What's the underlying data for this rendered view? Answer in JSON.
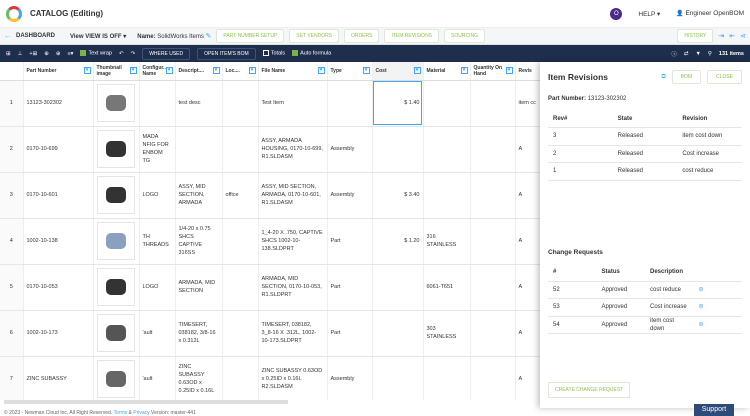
{
  "header": {
    "title": "CATALOG (Editing)",
    "avatar": "O",
    "help": "HELP ▾",
    "user": "Engineer OpenBOM"
  },
  "nav": {
    "dashboard": "DASHBOARD",
    "view": "View VIEW IS OFF ▾",
    "name_label": "Name:",
    "name": "SolidWorks Items",
    "tabs": [
      "PART NUMBER SETUP",
      "SET VENDORS",
      "ORDERS",
      "ITEM REVISIONS",
      "SOURCING"
    ],
    "history": "HISTORY"
  },
  "toolbar": {
    "text_wrap": "Text wrap",
    "where_used": "WHERE USED",
    "open_bom": "OPEN ITEM'S BOM",
    "totals": "Totals",
    "auto_formula": "Auto formula",
    "count": "131 items"
  },
  "columns": [
    "",
    "Part Number",
    "Thumbnail image",
    "Configur... Name",
    "Descript....",
    "Loc....",
    "File Name",
    "Type",
    "Cost",
    "Material",
    "Quantity On Hand",
    "Revis"
  ],
  "rows": [
    {
      "n": "1",
      "part": "13123-302302",
      "config": "",
      "desc": "test desc",
      "loc": "",
      "file": "Test Item",
      "type": "",
      "cost": "$ 1.40",
      "material": "",
      "qty": "",
      "rev": "item cc"
    },
    {
      "n": "2",
      "part": "0170-10-699",
      "config": "MADA NFIG FOR ENBOM TG",
      "desc": "",
      "loc": "",
      "file": "ASSY, ARMADA HOUSING, 0170-10-699, R1.SLDASM",
      "type": "Assembly",
      "cost": "",
      "material": "",
      "qty": "",
      "rev": "A"
    },
    {
      "n": "3",
      "part": "0170-10-601",
      "config": "LOGO",
      "desc": "ASSY, MID SECTION, ARMADA",
      "loc": "office",
      "file": "ASSY, MID SECTION, ARMADA, 0170-10-601, R1.SLDASM",
      "type": "Assembly",
      "cost": "$ 3.40",
      "material": "",
      "qty": "",
      "rev": "A"
    },
    {
      "n": "4",
      "part": "1002-10-138",
      "config": "TH THREADS",
      "desc": "1/4-20 x 0.75 SHCS CAPTIVE 316SS",
      "loc": "",
      "file": "1_4-20 X .750, CAPTIVE SHCS 1002-10-138.SLDPRT",
      "type": "Part",
      "cost": "$ 1.20",
      "material": "316 STAINLESS",
      "qty": "",
      "rev": "A"
    },
    {
      "n": "5",
      "part": "0170-10-053",
      "config": "LOGO",
      "desc": "ARMADA, MID SECTION",
      "loc": "",
      "file": "ARMADA, MID SECTION, 0170-10-053, R1.SLDPRT",
      "type": "Part",
      "cost": "",
      "material": "6061-T651",
      "qty": "",
      "rev": "A"
    },
    {
      "n": "6",
      "part": "1002-10-173",
      "config": "'ault",
      "desc": "TIMESERT, 038182, 3/8-16 x 0.312L",
      "loc": "",
      "file": "TIMESERT, 038182, 3_8-16 X .312L, 1002-10-173.SLDPRT",
      "type": "Part",
      "cost": "",
      "material": "303 STAINLESS",
      "qty": "",
      "rev": "A"
    },
    {
      "n": "7",
      "part": "ZINC SUBASSY",
      "config": "'ault",
      "desc": "ZINC SUBASSY 0.63OD x 0.25ID x 0.16L",
      "loc": "",
      "file": "ZINC SUBASSY 0.63OD x 0.25ID x 0.16L R2.SLDASM",
      "type": "Assembly",
      "cost": "",
      "material": "",
      "qty": "",
      "rev": "A"
    }
  ],
  "panel": {
    "title": "Item Revisions",
    "bom": "BOM",
    "close": "CLOSE",
    "pn_label": "Part Number:",
    "pn": "13123-302302",
    "rev_headers": [
      "Rev#",
      "State",
      "Revision"
    ],
    "revisions": [
      [
        "3",
        "Released",
        "item cost down"
      ],
      [
        "2",
        "Released",
        "Cost increase"
      ],
      [
        "1",
        "Released",
        "cost reduce"
      ]
    ],
    "cr_title": "Change Requests",
    "cr_headers": [
      "#",
      "Status",
      "Description"
    ],
    "changes": [
      [
        "52",
        "Approved",
        "cost reduce"
      ],
      [
        "53",
        "Approved",
        "Cost increase"
      ],
      [
        "54",
        "Approved",
        "item cost down"
      ]
    ],
    "create": "CREATE CHANGE REQUEST"
  },
  "footer": {
    "copy": "© 2023 - Newman Cloud Inc. All Right Reserved.",
    "terms": "Terms",
    "amp": "&",
    "privacy": "Privacy",
    "version": "Version: master-441"
  },
  "support": "Support"
}
